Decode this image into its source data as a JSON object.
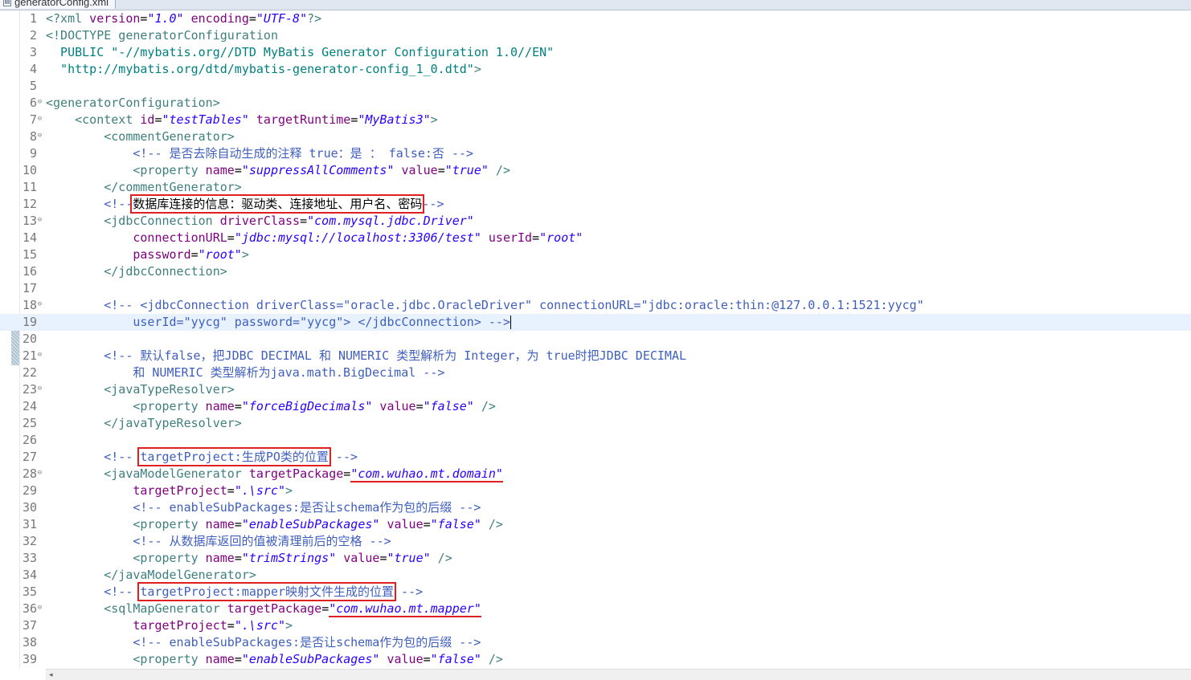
{
  "tab": {
    "title": "generatorConfig.xml",
    "icon": "xml-file-icon"
  },
  "colors": {
    "tag": "#3f7f7f",
    "attribute": "#7f007f",
    "value": "#2a00ff",
    "comment": "#3f5fbf",
    "highlight_box": "#e02020",
    "current_line": "#e8f2fe"
  },
  "editor": {
    "current_line": 19,
    "line_numbers": [
      "1",
      "2",
      "3",
      "4",
      "5",
      "6",
      "7",
      "8",
      "9",
      "10",
      "11",
      "12",
      "13",
      "14",
      "15",
      "16",
      "17",
      "18",
      "19",
      "20",
      "21",
      "22",
      "23",
      "24",
      "25",
      "26",
      "27",
      "28",
      "29",
      "30",
      "31",
      "32",
      "33",
      "34",
      "35",
      "36",
      "37",
      "38",
      "39"
    ],
    "lines": [
      {
        "tok": [
          "<?xml",
          " version",
          "=",
          "\"1.0\"",
          " encoding",
          "=",
          "\"UTF-8\"",
          "?>"
        ]
      },
      {
        "tok": [
          "<!DOCTYPE generatorConfiguration"
        ]
      },
      {
        "tok": [
          "  PUBLIC ",
          "\"-//mybatis.org//DTD MyBatis Generator Configuration 1.0//EN\""
        ]
      },
      {
        "tok": [
          "  ",
          "\"http://mybatis.org/dtd/mybatis-generator-config_1_0.dtd\"",
          ">"
        ]
      },
      {
        "tok": [
          ""
        ]
      },
      {
        "tok": [
          "<generatorConfiguration>"
        ]
      },
      {
        "tok": [
          "    ",
          "<context",
          " id",
          "=",
          "\"testTables\"",
          " targetRuntime",
          "=",
          "\"MyBatis3\"",
          ">"
        ]
      },
      {
        "tok": [
          "        ",
          "<commentGenerator>"
        ]
      },
      {
        "tok": [
          "            ",
          "<!-- 是否去除自动生成的注释 true：是 ： false:否 -->"
        ]
      },
      {
        "tok": [
          "            ",
          "<property",
          " name",
          "=",
          "\"suppressAllComments\"",
          " value",
          "=",
          "\"true\"",
          " />"
        ]
      },
      {
        "tok": [
          "        ",
          "</commentGenerator>"
        ]
      },
      {
        "tok": [
          "        ",
          "<!--",
          "数据库连接的信息：驱动类、连接地址、用户名、密码",
          "-->"
        ]
      },
      {
        "tok": [
          "        ",
          "<jdbcConnection",
          " driverClass",
          "=",
          "\"com.mysql.jdbc.Driver\""
        ]
      },
      {
        "tok": [
          "            ",
          "connectionURL",
          "=",
          "\"jdbc:mysql://localhost:3306/test\"",
          " userId",
          "=",
          "\"root\""
        ]
      },
      {
        "tok": [
          "            ",
          "password",
          "=",
          "\"root\"",
          ">"
        ]
      },
      {
        "tok": [
          "        ",
          "</jdbcConnection>"
        ]
      },
      {
        "tok": [
          ""
        ]
      },
      {
        "tok": [
          "        ",
          "<!-- <jdbcConnection driverClass=\"oracle.jdbc.OracleDriver\" connectionURL=\"jdbc:oracle:thin:@127.0.0.1:1521:yycg\""
        ]
      },
      {
        "tok": [
          "            ",
          "userId=\"yycg\" password=\"yycg\"> </jdbcConnection> -->"
        ]
      },
      {
        "tok": [
          ""
        ]
      },
      {
        "tok": [
          "        ",
          "<!-- 默认false，把JDBC DECIMAL 和 NUMERIC 类型解析为 Integer，为 true时把JDBC DECIMAL"
        ]
      },
      {
        "tok": [
          "            ",
          "和 NUMERIC 类型解析为java.math.BigDecimal -->"
        ]
      },
      {
        "tok": [
          "        ",
          "<javaTypeResolver>"
        ]
      },
      {
        "tok": [
          "            ",
          "<property",
          " name",
          "=",
          "\"forceBigDecimals\"",
          " value",
          "=",
          "\"false\"",
          " />"
        ]
      },
      {
        "tok": [
          "        ",
          "</javaTypeResolver>"
        ]
      },
      {
        "tok": [
          ""
        ]
      },
      {
        "tok": [
          "        ",
          "<!-- ",
          "targetProject:生成PO类的位置",
          " -->"
        ]
      },
      {
        "tok": [
          "        ",
          "<javaModelGenerator",
          " targetPackage",
          "=",
          "\"com.wuhao.mt.domain\""
        ]
      },
      {
        "tok": [
          "            ",
          "targetProject",
          "=",
          "\".\\src\"",
          ">"
        ]
      },
      {
        "tok": [
          "            ",
          "<!-- enableSubPackages:是否让schema作为包的后缀 -->"
        ]
      },
      {
        "tok": [
          "            ",
          "<property",
          " name",
          "=",
          "\"enableSubPackages\"",
          " value",
          "=",
          "\"false\"",
          " />"
        ]
      },
      {
        "tok": [
          "            ",
          "<!-- 从数据库返回的值被清理前后的空格 -->"
        ]
      },
      {
        "tok": [
          "            ",
          "<property",
          " name",
          "=",
          "\"trimStrings\"",
          " value",
          "=",
          "\"true\"",
          " />"
        ]
      },
      {
        "tok": [
          "        ",
          "</javaModelGenerator>"
        ]
      },
      {
        "tok": [
          "        ",
          "<!-- ",
          "targetProject:mapper映射文件生成的位置",
          " -->"
        ]
      },
      {
        "tok": [
          "        ",
          "<sqlMapGenerator",
          " targetPackage",
          "=",
          "\"com.wuhao.mt.mapper\""
        ]
      },
      {
        "tok": [
          "            ",
          "targetProject",
          "=",
          "\".\\src\"",
          ">"
        ]
      },
      {
        "tok": [
          "            ",
          "<!-- enableSubPackages:是否让schema作为包的后缀 -->"
        ]
      },
      {
        "tok": [
          "            ",
          "<property",
          " name",
          "=",
          "\"enableSubPackages\"",
          " value",
          "=",
          "\"false\"",
          " />"
        ]
      }
    ],
    "fold_markers": [
      "6",
      "7",
      "8",
      "13",
      "18",
      "21",
      "23",
      "28",
      "36"
    ]
  },
  "scrollbar": {
    "left_arrow": "◂"
  }
}
